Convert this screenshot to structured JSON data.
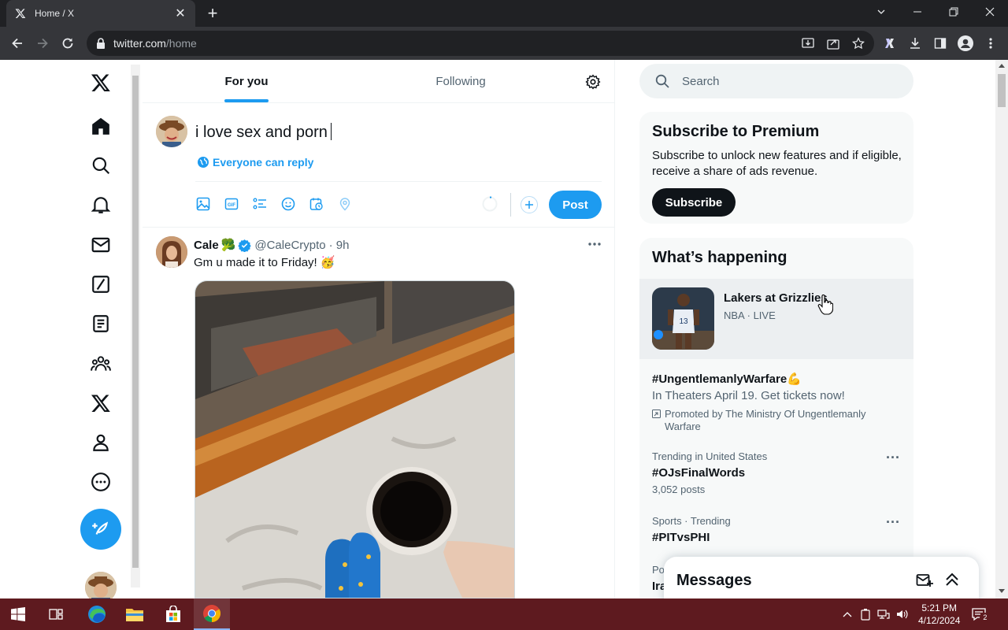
{
  "browser": {
    "tab_title": "Home / X",
    "url_domain": "twitter.com",
    "url_path": "/home"
  },
  "feed": {
    "tabs": [
      "For you",
      "Following"
    ],
    "active_tab": "For you",
    "composer": {
      "text": "i love sex and porn",
      "reply_setting": "Everyone can reply",
      "post_label": "Post"
    },
    "tweet": {
      "name": "Cale",
      "name_emoji": "🥦",
      "handle": "@CaleCrypto",
      "time": "· 9h",
      "text": "Gm u made it to Friday! 🥳"
    }
  },
  "right": {
    "search_placeholder": "Search",
    "premium": {
      "title": "Subscribe to Premium",
      "body": "Subscribe to unlock new features and if eligible, receive a share of ads revenue.",
      "button": "Subscribe"
    },
    "happening": {
      "title": "What’s happening",
      "live": {
        "title": "Lakers at Grizzlies",
        "meta": "NBA · LIVE"
      },
      "promoted": {
        "tag": "#UngentlemanlyWarfare💪",
        "desc": "In Theaters April 19. Get tickets now!",
        "by": "Promoted by The Ministry Of Ungentlemanly Warfare"
      },
      "trends": [
        {
          "context": "Trending in United States",
          "name": "#OJsFinalWords",
          "count": "3,052 posts"
        },
        {
          "context": "Sports · Trending",
          "name": "#PITvsPHI"
        }
      ],
      "partial": [
        {
          "context": "Po"
        },
        {
          "name": "Ira"
        }
      ]
    }
  },
  "messages": {
    "title": "Messages"
  },
  "taskbar": {
    "time": "5:21 PM",
    "date": "4/12/2024",
    "notif_count": "2"
  }
}
